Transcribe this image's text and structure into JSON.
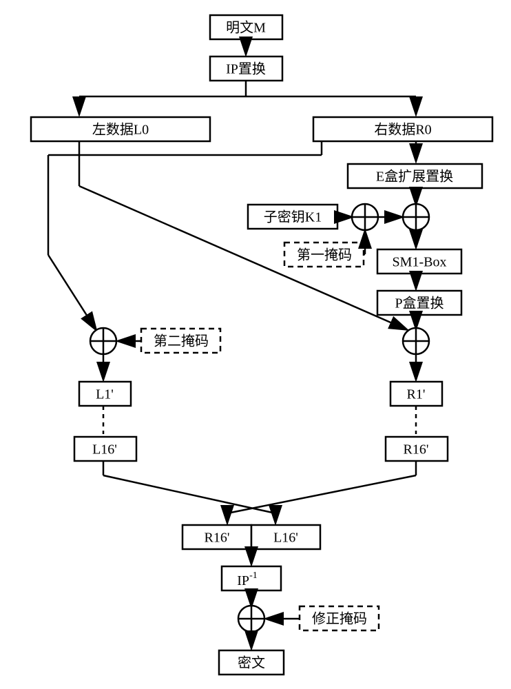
{
  "nodes": {
    "plaintext": "明文M",
    "ip": "IP置换",
    "l0": "左数据L0",
    "r0": "右数据R0",
    "ebox": "E盒扩展置换",
    "subkey": "子密钥K1",
    "mask1": "第一掩码",
    "sm1": "SM1-Box",
    "pbox": "P盒置换",
    "mask2": "第二掩码",
    "l1p": "L1'",
    "r1p": "R1'",
    "l16p": "L16'",
    "r16p": "R16'",
    "r16p_swap": "R16'",
    "l16p_swap": "L16'",
    "ipinv_pre": "IP",
    "ipinv_sup": "-1",
    "corrmask": "修正掩码",
    "cipher": "密文"
  }
}
